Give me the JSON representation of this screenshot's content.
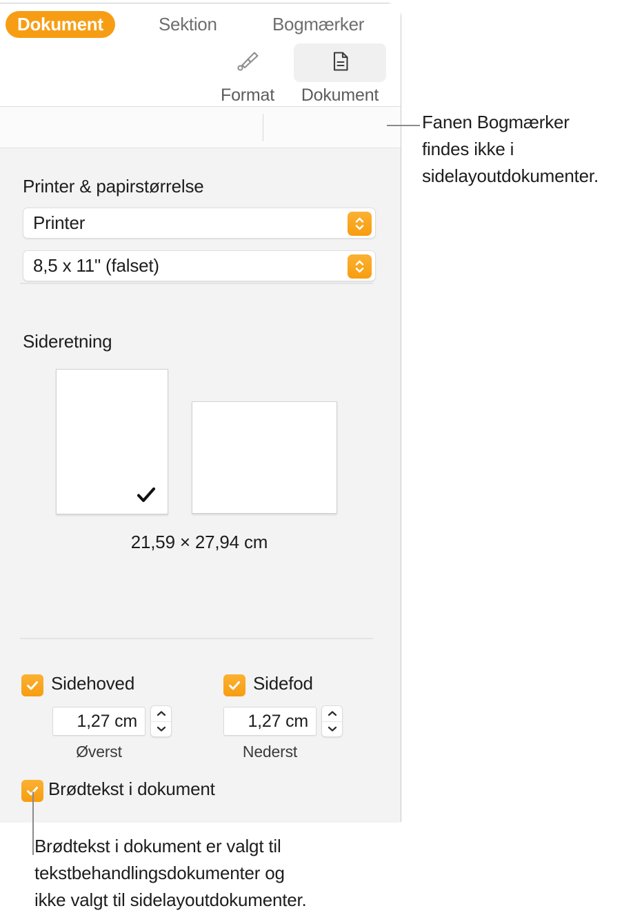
{
  "toolbar": {
    "buttons": [
      {
        "id": "format",
        "label": "Format",
        "icon": "paintbrush-icon",
        "selected": false
      },
      {
        "id": "dokument",
        "label": "Dokument",
        "icon": "document-icon",
        "selected": true
      }
    ]
  },
  "tabs": [
    {
      "id": "dokument",
      "label": "Dokument",
      "active": true
    },
    {
      "id": "sektion",
      "label": "Sektion",
      "active": false
    },
    {
      "id": "bogmaerker",
      "label": "Bogmærker",
      "active": false
    }
  ],
  "printer_section": {
    "title": "Printer & papirstørrelse",
    "printer_popup": {
      "value": "Printer",
      "icon": "up-down-chevrons-icon"
    },
    "paper_popup": {
      "value": "8,5 x 11\" (falset)",
      "icon": "up-down-chevrons-icon"
    }
  },
  "orientation_section": {
    "title": "Sideretning",
    "options": [
      {
        "id": "portrait",
        "selected": true,
        "check_icon": "checkmark-icon"
      },
      {
        "id": "landscape",
        "selected": false,
        "check_icon": ""
      }
    ],
    "dimensions": "21,59 × 27,94 cm"
  },
  "header_footer": {
    "header": {
      "checkbox_label": "Sidehoved",
      "checked": true,
      "value": "1,27 cm",
      "sublabel": "Øverst",
      "stepper_icon": "up-down-chevrons-icon"
    },
    "footer": {
      "checkbox_label": "Sidefod",
      "checked": true,
      "value": "1,27 cm",
      "sublabel": "Nederst",
      "stepper_icon": "up-down-chevrons-icon"
    },
    "body_text": {
      "checkbox_label": "Brødtekst i dokument",
      "checked": true
    }
  },
  "callouts": {
    "top": "Fanen Bogmærker\nfindes ikke i\nsidelayoutdokumenter.",
    "bottom": "Brødtekst i dokument er valgt til\ntekstbehandlingsdokumenter og\nikke valgt til sidelayoutdokumenter."
  },
  "colors": {
    "accent_orange": "#F79D14",
    "panel_background": "#F3F3F3",
    "text_primary": "#1D1D1D",
    "text_secondary": "#6E6E6E",
    "leader_line": "#8A8A8A"
  }
}
